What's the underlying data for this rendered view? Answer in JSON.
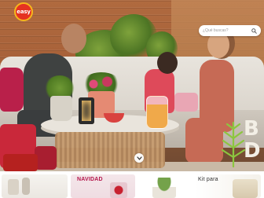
{
  "header": {
    "logo_text": "easy",
    "search": {
      "placeholder": "¿Qué buscas?"
    }
  },
  "hero": {
    "promo_text": "B\nD"
  },
  "categories": [
    {
      "label": ""
    },
    {
      "label": "NAVIDAD"
    },
    {
      "label": ""
    },
    {
      "label": "Kit para"
    }
  ],
  "colors": {
    "brand_red": "#e53222",
    "brand_yellow": "#f6b71c",
    "christmas_red": "#b4154a"
  },
  "icons": {
    "search": "search-icon",
    "scroll": "chevron-down-icon",
    "promo_art": "tree-icon"
  }
}
